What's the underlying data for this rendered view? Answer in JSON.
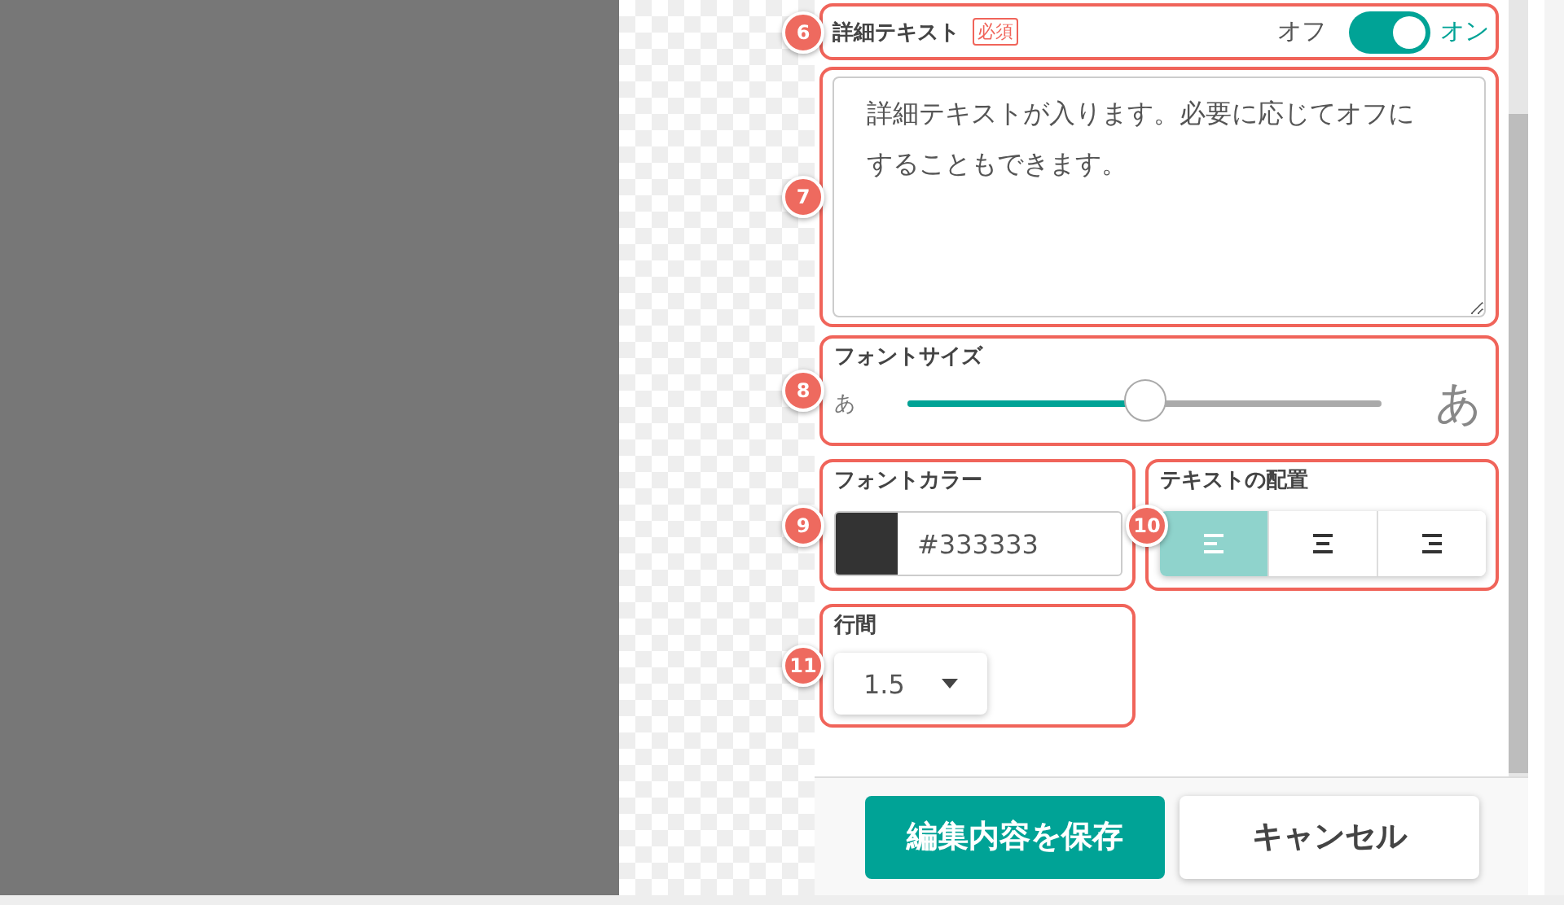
{
  "detail_text": {
    "marker": "6",
    "label": "詳細テキスト",
    "required_badge": "必須",
    "toggle": {
      "off_label": "オフ",
      "on_label": "オン",
      "on": true
    }
  },
  "detail_textarea": {
    "marker": "7",
    "value": "詳細テキストが入ります。必要に応じてオフにすることもできます。"
  },
  "font_size": {
    "marker": "8",
    "label": "フォントサイズ",
    "small_glyph": "あ",
    "large_glyph": "あ",
    "level": 0.5
  },
  "font_color": {
    "marker": "9",
    "label": "フォントカラー",
    "value": "#333333"
  },
  "text_alignment": {
    "marker": "10",
    "label": "テキストの配置",
    "options": [
      {
        "kind": "left",
        "selected": true
      },
      {
        "kind": "center",
        "selected": false
      },
      {
        "kind": "right",
        "selected": false
      }
    ]
  },
  "line_spacing": {
    "marker": "11",
    "label": "行間",
    "value": "1.5"
  },
  "buttons": [
    {
      "kind": "primary",
      "label": "編集内容を保存"
    },
    {
      "kind": "secondary",
      "label": "キャンセル"
    }
  ]
}
